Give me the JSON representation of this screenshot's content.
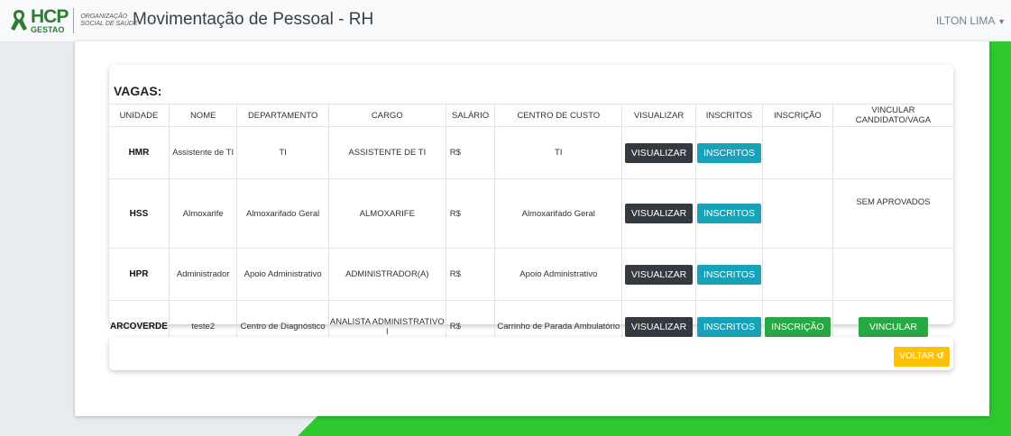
{
  "header": {
    "logo_text": "HCP",
    "logo_sub": "GESTAO",
    "org_line1": "ORGANIZAÇÃO",
    "org_line2": "SOCIAL DE SAÚDE",
    "title": "Movimentação de Pessoal - RH",
    "user": "ILTON LIMA"
  },
  "vagas": {
    "title": "VAGAS:",
    "columns": [
      "UNIDADE",
      "NOME",
      "DEPARTAMENTO",
      "CARGO",
      "SALÁRIO",
      "CENTRO DE CUSTO",
      "VISUALIZAR",
      "INSCRITOS",
      "INSCRIÇÃO",
      "VINCULAR CANDIDATO/VAGA"
    ],
    "rows": [
      {
        "unidade": "HMR",
        "nome": "Assistente de TI",
        "departamento": "TI",
        "cargo": "ASSISTENTE DE TI",
        "salario": "R$",
        "centro_custo": "TI",
        "visualizar": "VISUALIZAR",
        "inscritos": "INSCRITOS",
        "inscricao": "",
        "vincular": ""
      },
      {
        "unidade": "HSS",
        "nome": "Almoxarife",
        "departamento": "Almoxarifado Geral",
        "cargo": "ALMOXARIFE",
        "salario": "R$",
        "centro_custo": "Almoxarifado Geral",
        "visualizar": "VISUALIZAR",
        "inscritos": "INSCRITOS",
        "inscricao": "",
        "vincular": "SEM APROVADOS"
      },
      {
        "unidade": "HPR",
        "nome": "Administrador",
        "departamento": "Apoio Administrativo",
        "cargo": "ADMINISTRADOR(A)",
        "salario": "R$",
        "centro_custo": "Apoio Administrativo",
        "visualizar": "VISUALIZAR",
        "inscritos": "INSCRITOS",
        "inscricao": "",
        "vincular": ""
      },
      {
        "unidade": "ARCOVERDE",
        "nome": "teste2",
        "departamento": "Centro de Diagnóstico",
        "cargo": "ANALISTA ADMINISTRATIVO I",
        "salario": "R$",
        "centro_custo": "Carrinho de Parada Ambulatório",
        "visualizar": "VISUALIZAR",
        "inscritos": "INSCRITOS",
        "inscricao": "INSCRIÇÃO",
        "vincular": "VINCULAR"
      }
    ]
  },
  "footer": {
    "voltar_label": "VOLTAR"
  },
  "colors": {
    "accent_green": "#2ec72e",
    "brand_green": "#2e7d32",
    "dark": "#343a40",
    "info": "#17a2b8",
    "success": "#28a745",
    "warning": "#ffc107"
  }
}
